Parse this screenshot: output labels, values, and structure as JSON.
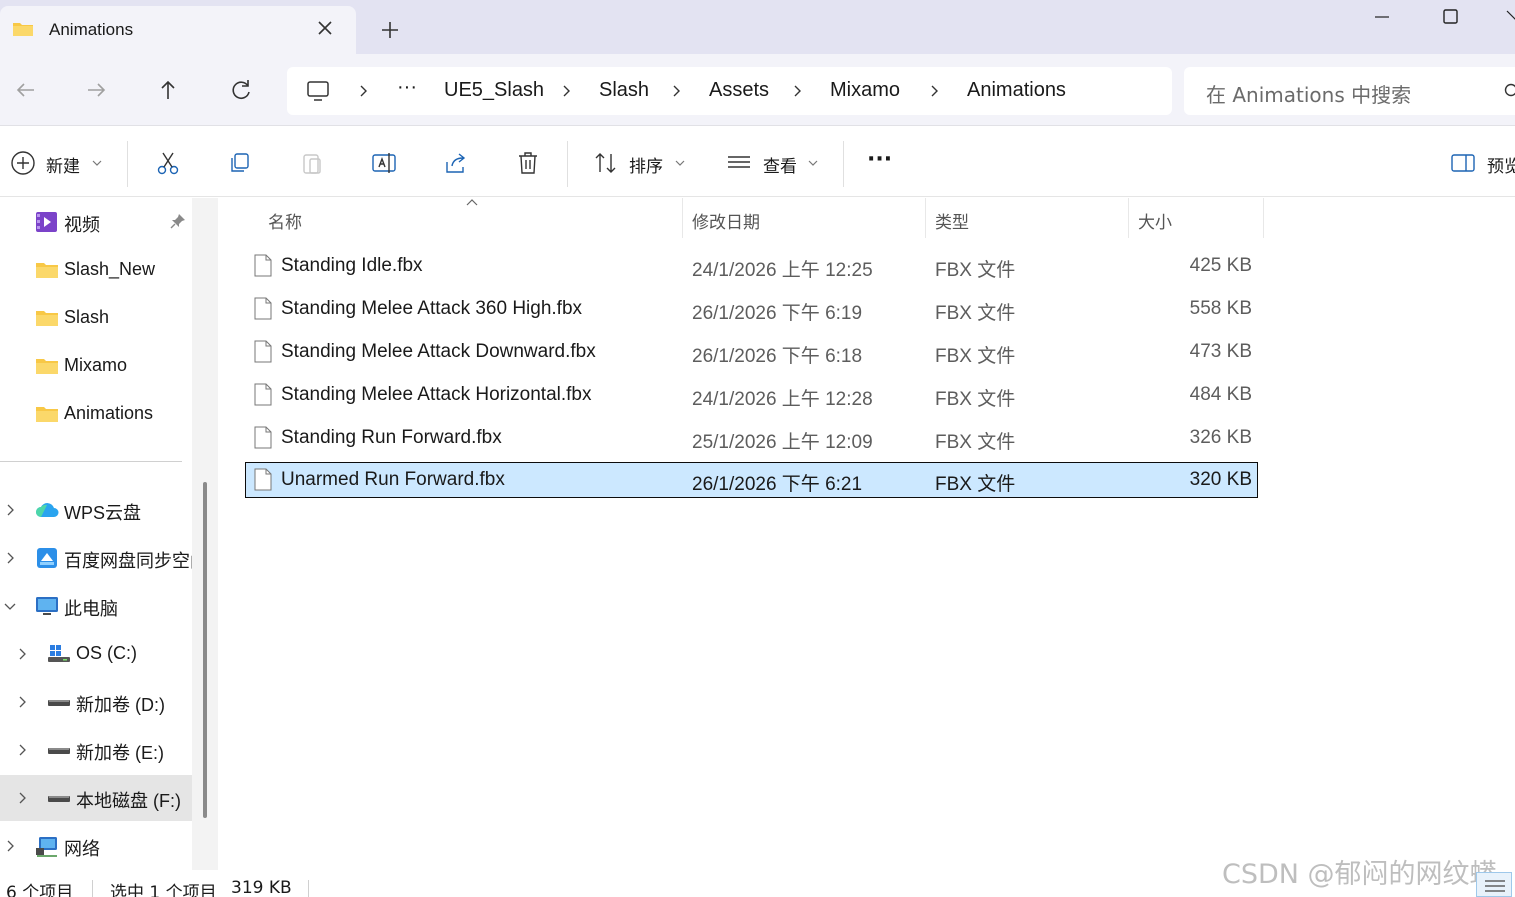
{
  "window": {
    "tab_title": "Animations",
    "icons": [
      "folder-icon",
      "close-icon",
      "plus-icon",
      "minimize-icon",
      "maximize-icon"
    ]
  },
  "address_bar": {
    "overflow": "···",
    "crumbs": [
      "UE5_Slash",
      "Slash",
      "Assets",
      "Mixamo",
      "Animations"
    ],
    "search_placeholder": "在 Animations 中搜索"
  },
  "toolbar": {
    "new_label": "新建",
    "sort_label": "排序",
    "view_label": "查看",
    "more_label": "···",
    "preview_label": "预览"
  },
  "sidebar": {
    "quick_access": [
      {
        "label": "视频",
        "icon": "video-folder-icon",
        "pinned": true
      },
      {
        "label": "Slash_New",
        "icon": "folder-icon"
      },
      {
        "label": "Slash",
        "icon": "folder-icon"
      },
      {
        "label": "Mixamo",
        "icon": "folder-icon"
      },
      {
        "label": "Animations",
        "icon": "folder-icon"
      }
    ],
    "locations": [
      {
        "label": "WPS云盘",
        "icon": "cloud-icon",
        "indent": 0
      },
      {
        "label": "百度网盘同步空间",
        "icon": "baidu-netdisk-icon",
        "indent": 0
      },
      {
        "label": "此电脑",
        "icon": "computer-icon",
        "indent": 0,
        "expanded": true
      },
      {
        "label": "OS (C:)",
        "icon": "windows-drive-icon",
        "indent": 1
      },
      {
        "label": "新加卷 (D:)",
        "icon": "drive-icon",
        "indent": 1
      },
      {
        "label": "新加卷 (E:)",
        "icon": "drive-icon",
        "indent": 1
      },
      {
        "label": "本地磁盘 (F:)",
        "icon": "drive-icon",
        "indent": 1,
        "selected": true
      },
      {
        "label": "网络",
        "icon": "network-icon",
        "indent": 0
      }
    ]
  },
  "columns": {
    "name": "名称",
    "modified": "修改日期",
    "type": "类型",
    "size": "大小"
  },
  "files": [
    {
      "name": "Standing Idle.fbx",
      "modified": "24/1/2026 上午 12:25",
      "type": "FBX 文件",
      "size": "425 KB"
    },
    {
      "name": "Standing Melee Attack 360 High.fbx",
      "modified": "26/1/2026 下午 6:19",
      "type": "FBX 文件",
      "size": "558 KB"
    },
    {
      "name": "Standing Melee Attack Downward.fbx",
      "modified": "26/1/2026 下午 6:18",
      "type": "FBX 文件",
      "size": "473 KB"
    },
    {
      "name": "Standing Melee Attack Horizontal.fbx",
      "modified": "24/1/2026 上午 12:28",
      "type": "FBX 文件",
      "size": "484 KB"
    },
    {
      "name": "Standing Run Forward.fbx",
      "modified": "25/1/2026 上午 12:09",
      "type": "FBX 文件",
      "size": "326 KB"
    },
    {
      "name": "Unarmed Run Forward.fbx",
      "modified": "26/1/2026 下午 6:21",
      "type": "FBX 文件",
      "size": "320 KB",
      "selected": true
    }
  ],
  "status": {
    "item_count": "6 个项目",
    "selection": "选中 1 个项目",
    "selection_size": "319 KB"
  },
  "watermark": "CSDN @郁闷的网纹蟒",
  "colors": {
    "titlebar_bg": "#e3e3f2",
    "nav_bg": "#f3f3f9",
    "selection_bg": "#cce8ff",
    "folder_yellow": "#f8c846"
  }
}
